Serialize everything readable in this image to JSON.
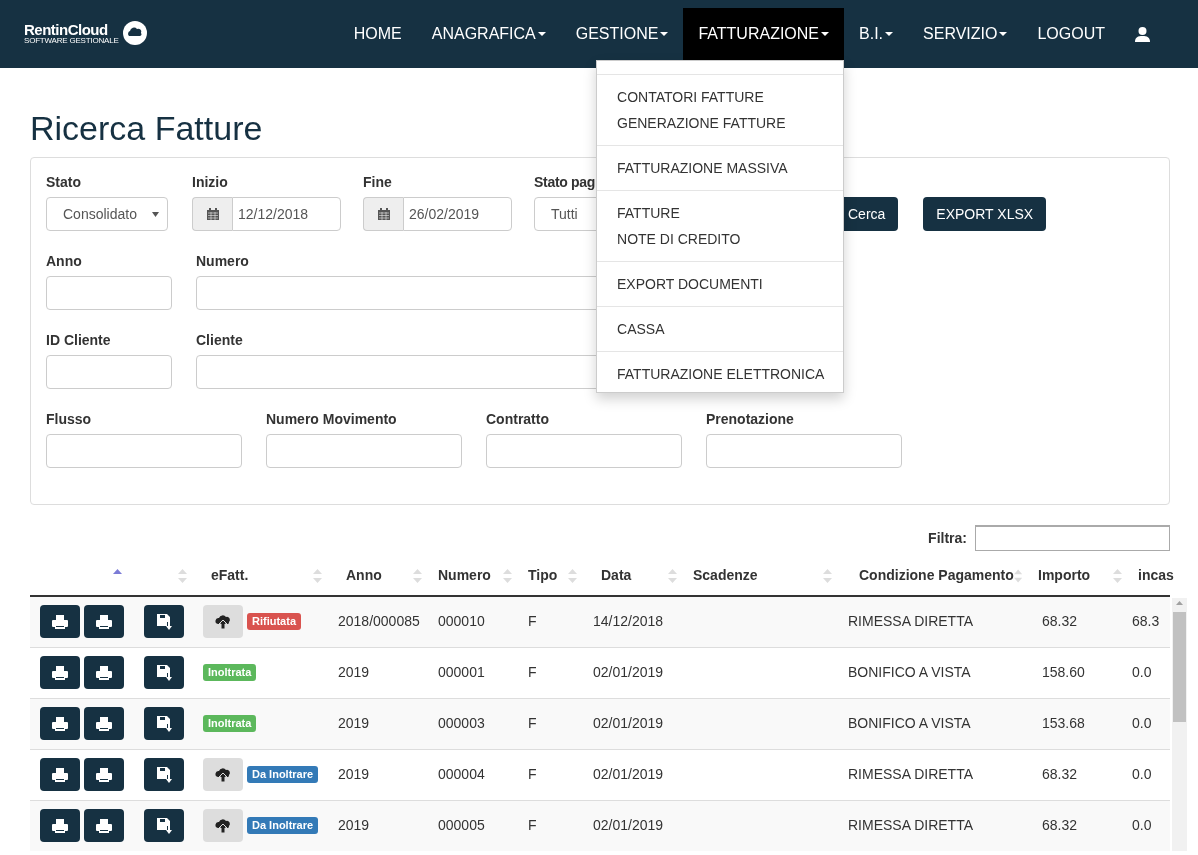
{
  "brand": {
    "name": "RentinCloud",
    "tagline": "SOFTWARE GESTIONALE"
  },
  "nav": [
    {
      "label": "HOME",
      "dropdown": false,
      "selected": false
    },
    {
      "label": "ANAGRAFICA",
      "dropdown": true,
      "selected": false
    },
    {
      "label": "GESTIONE",
      "dropdown": true,
      "selected": false
    },
    {
      "label": "FATTURAZIONE",
      "dropdown": true,
      "selected": true
    },
    {
      "label": "B.I.",
      "dropdown": true,
      "selected": false
    },
    {
      "label": "SERVIZIO",
      "dropdown": true,
      "selected": false
    },
    {
      "label": "LOGOUT",
      "dropdown": false,
      "selected": false
    }
  ],
  "menu": [
    [
      "CONTATORI FATTURE",
      "GENERAZIONE FATTURE"
    ],
    [
      "FATTURAZIONE MASSIVA"
    ],
    [
      "FATTURE",
      "NOTE DI CREDITO"
    ],
    [
      "EXPORT DOCUMENTI"
    ],
    [
      "CASSA"
    ],
    [
      "FATTURAZIONE ELETTRONICA"
    ]
  ],
  "title": "Ricerca Fatture",
  "filters": {
    "stato": {
      "label": "Stato",
      "value": "Consolidato"
    },
    "inizio": {
      "label": "Inizio",
      "value": "12/12/2018"
    },
    "fine": {
      "label": "Fine",
      "value": "26/02/2019"
    },
    "stato_pag": {
      "label": "Stato pag",
      "value": "Tutti"
    },
    "buttons": [
      "Cerca",
      "EXPORT XLSX"
    ],
    "rows": [
      [
        {
          "label": "Anno"
        },
        {
          "label": "Numero"
        }
      ],
      [
        {
          "label": "ID Cliente"
        },
        {
          "label": "Cliente"
        }
      ],
      [
        {
          "label": "Flusso"
        },
        {
          "label": "Numero Movimento"
        },
        {
          "label": "Contratto"
        },
        {
          "label": "Prenotazione"
        }
      ]
    ]
  },
  "filter_label": "Filtra:",
  "table": {
    "columns": [
      "",
      "",
      "eFatt.",
      "Anno",
      "Numero",
      "Tipo",
      "Data",
      "Scadenze",
      "Condizione Pagamento",
      "Importo",
      "incas"
    ],
    "rows": [
      {
        "upload_button": true,
        "color": "#d9534f",
        "cells": [
          "",
          "",
          "Rifiutata",
          "2018/000085",
          "000010",
          "F",
          "14/12/2018",
          "",
          "RIMESSA DIRETTA",
          "68.32",
          "68.3"
        ]
      },
      {
        "upload_button": false,
        "color": "#5cb85c",
        "cells": [
          "",
          "",
          "Inoltrata",
          "2019",
          "000001",
          "F",
          "02/01/2019",
          "",
          "BONIFICO A VISTA",
          "158.60",
          "0.0"
        ]
      },
      {
        "upload_button": false,
        "color": "#5cb85c",
        "cells": [
          "",
          "",
          "Inoltrata",
          "2019",
          "000003",
          "F",
          "02/01/2019",
          "",
          "BONIFICO A VISTA",
          "153.68",
          "0.0"
        ]
      },
      {
        "upload_button": true,
        "color": "#337ab7",
        "cells": [
          "",
          "",
          "Da Inoltrare",
          "2019",
          "000004",
          "F",
          "02/01/2019",
          "",
          "RIMESSA DIRETTA",
          "68.32",
          "0.0"
        ]
      },
      {
        "upload_button": true,
        "color": "#337ab7",
        "cells": [
          "",
          "",
          "Da Inoltrare",
          "2019",
          "000005",
          "F",
          "02/01/2019",
          "",
          "RIMESSA DIRETTA",
          "68.32",
          "0.0"
        ]
      }
    ]
  }
}
